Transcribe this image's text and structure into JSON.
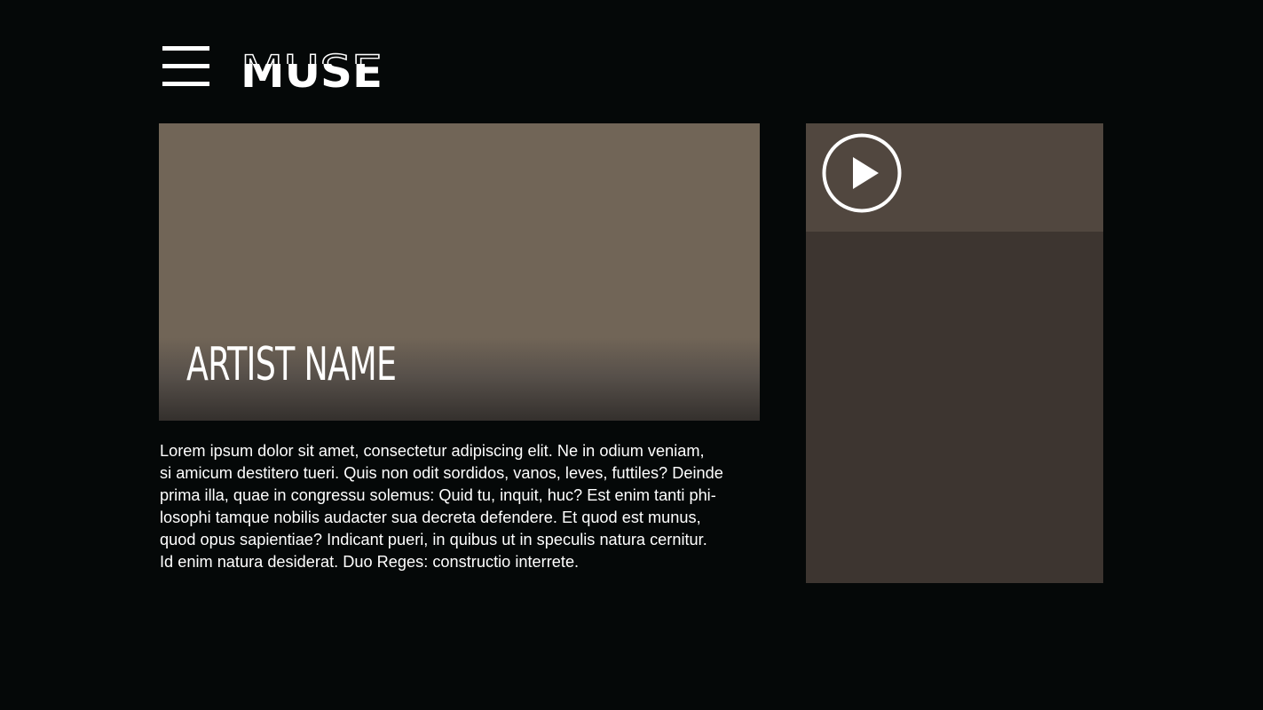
{
  "header": {
    "brand": "MUSE",
    "menu_icon": "hamburger-menu-icon"
  },
  "hero": {
    "title": "ARTIST NAME"
  },
  "bio": {
    "lines": [
      "Lorem ipsum dolor sit amet, consectetur adipiscing elit. Ne in odium veniam,",
      "si amicum destitero tueri. Quis non odit sordidos, vanos, leves, futtiles? Deinde",
      "prima illa, quae in congressu solemus: Quid tu, inquit, huc? Est enim tanti phi-",
      "losophi tamque nobilis audacter sua decreta defendere. Et quod est munus,",
      "quod opus sapientiae? Indicant pueri, in quibus ut in speculis natura cernitur.",
      "Id enim natura desiderat. Duo Reges: constructio interrete."
    ]
  },
  "media": {
    "play_icon": "play-circle-icon"
  },
  "colors": {
    "background": "#050808",
    "hero": "#716557",
    "panel_header": "#51473f",
    "panel_body": "#3d3530",
    "text": "#ffffff"
  }
}
